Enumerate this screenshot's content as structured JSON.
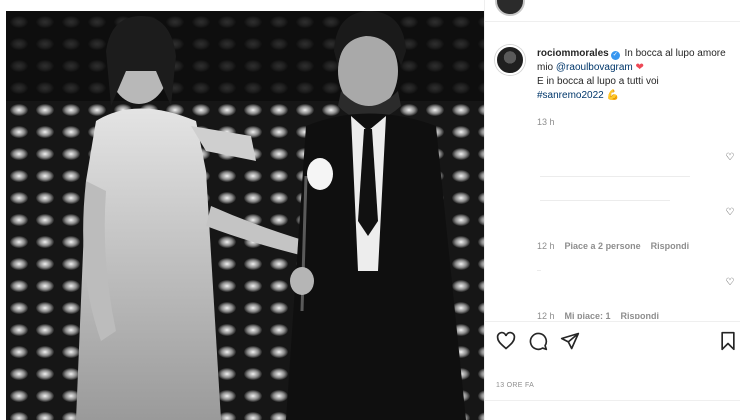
{
  "post": {
    "username": "rociommorales",
    "caption_pre": "In bocca al lupo amore mio",
    "mention": "@raoulbovagram",
    "caption_line2": "E in bocca al lupo a tutti voi",
    "hashtag": "#sanremo2022",
    "caption_time": "13 h",
    "date_label": "13 ORE FA"
  },
  "comments": [
    {
      "time": "12 h",
      "likes": "Piace a 2 persone",
      "reply": "Rispondi"
    },
    {
      "time": "12 h",
      "likes": "Mi piace: 1",
      "reply": "Rispondi"
    }
  ],
  "icons": {
    "like": "heart-outline-icon",
    "comment": "comment-bubble-icon",
    "share": "paper-plane-icon",
    "save": "bookmark-icon"
  },
  "colors": {
    "link": "#00376b",
    "verified": "#3897f0",
    "heart": "#ed4956",
    "muted": "#8e8e8e"
  }
}
